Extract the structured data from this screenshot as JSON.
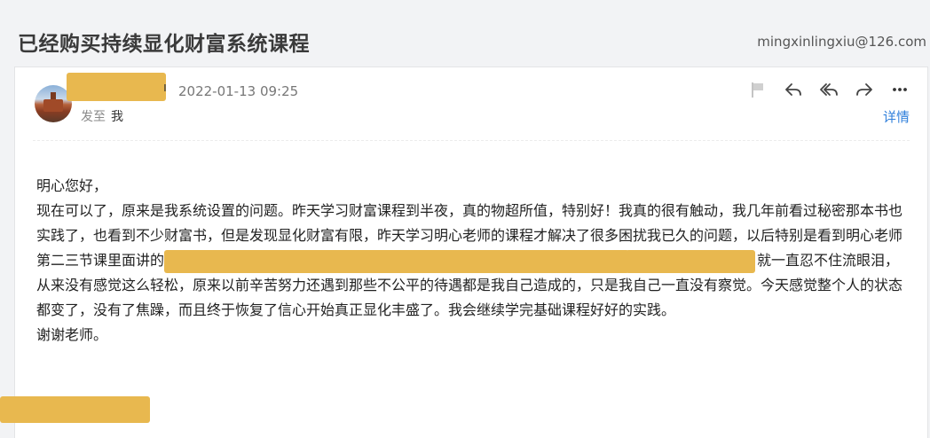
{
  "header": {
    "subject": "已经购买持续显化财富系统课程",
    "account": "mingxinlingxiu@126.com"
  },
  "message": {
    "sender_tail": "ı",
    "date": "2022-01-13 09:25",
    "to_label": "发至",
    "to_value": "我",
    "details_label": "详情",
    "actions": [
      "flag-icon",
      "reply-icon",
      "reply-all-icon",
      "forward-icon",
      "more-icon"
    ]
  },
  "body": {
    "greeting": "明心您好，",
    "para1_a": "现在可以了，原来是我系统设置的问题。昨天学习财富课程到半夜，真的物超所值，特别好！我真的很有触动，我几年前看过秘密那本书也实践了，也看到不少财富书，但是发现显化财富有限，昨天学习明心老师的课程才解决了很多困扰我已久的问题，以后特别是看到明心老师第二三节课里面讲的",
    "para1_b": "就一直忍不住流眼泪，从来没有感觉这么轻松，原来以前辛苦努力还遇到那些不公平的待遇都是我自己造成的，只是我自己一直没有察觉。今天感觉整个人的状态都变了，没有了焦躁，而且终于恢复了信心开始真正显化丰盛了。我会继续学完基础课程好好的实践。",
    "thanks": "谢谢老师。"
  },
  "colors": {
    "accent": "#2f7fdb",
    "redaction": "#e8b84f"
  }
}
